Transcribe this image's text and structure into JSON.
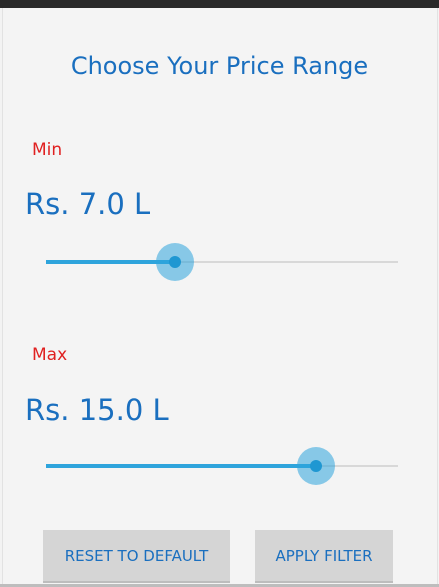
{
  "dialog": {
    "title": "Choose Your Price Range"
  },
  "min": {
    "label": "Min",
    "value_text": "Rs. 7.0 L",
    "slider_fraction": 0.367
  },
  "max": {
    "label": "Max",
    "value_text": "Rs. 15.0 L",
    "slider_fraction": 0.766
  },
  "buttons": {
    "reset": "RESET TO DEFAULT",
    "apply": "APPLY FILTER"
  },
  "colors": {
    "accent": "#2ea4dc",
    "title": "#1a6fbf",
    "label": "#e02020",
    "button_bg": "#d5d5d5"
  }
}
